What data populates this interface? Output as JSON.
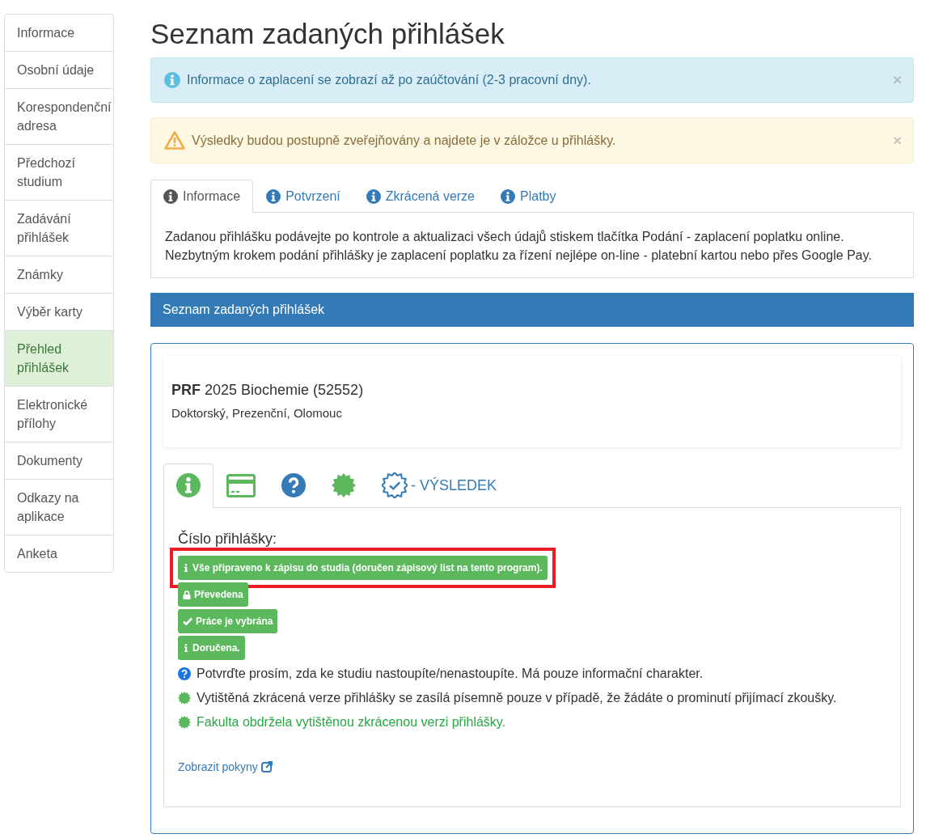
{
  "sidebar": {
    "items": [
      {
        "label": "Informace",
        "selected": false
      },
      {
        "label": "Osobní údaje",
        "selected": false
      },
      {
        "label": "Korespondenční adresa",
        "selected": false
      },
      {
        "label": "Předchozí studium",
        "selected": false
      },
      {
        "label": "Zadávání přihlášek",
        "selected": false
      },
      {
        "label": "Známky",
        "selected": false
      },
      {
        "label": "Výběr karty",
        "selected": false
      },
      {
        "label": "Přehled přihlášek",
        "selected": true
      },
      {
        "label": "Elektronické přílohy",
        "selected": false
      },
      {
        "label": "Dokumenty",
        "selected": false
      },
      {
        "label": "Odkazy na aplikace",
        "selected": false
      },
      {
        "label": "Anketa",
        "selected": false
      }
    ]
  },
  "title": "Seznam zadaných přihlášek",
  "alerts": [
    {
      "kind": "info",
      "text": "Informace o zaplacení se zobrazí až po zaúčtování (2-3 pracovní dny).",
      "close": "×"
    },
    {
      "kind": "warning",
      "text": "Výsledky budou postupně zveřejňovány a najdete je v záložce u přihlášky.",
      "close": "×"
    }
  ],
  "tabs": [
    {
      "label": "Informace",
      "selected": true
    },
    {
      "label": "Potvrzení",
      "selected": false
    },
    {
      "label": "Zkrácená verze",
      "selected": false
    },
    {
      "label": "Platby",
      "selected": false
    }
  ],
  "tab_content": [
    "Zadanou přihlášku podávejte po kontrole a aktualizaci všech údajů stiskem tlačítka Podání - zaplacení poplatku online.",
    "Nezbytným krokem podání přihlášky je zaplacení poplatku za řízení nejlépe on-line - platební kartou nebo přes Google Pay."
  ],
  "panel": {
    "heading": "Seznam zadaných přihlášek",
    "application": {
      "title": "**PRF** 2025 Biochemie (52552)",
      "details": "Doktorský, Prezenční, Olomouc",
      "icon_tabs": [
        {
          "kind": "info",
          "selected": true
        },
        {
          "kind": "card",
          "selected": false
        },
        {
          "kind": "question",
          "selected": false
        },
        {
          "kind": "seal",
          "selected": false
        },
        {
          "kind": "result",
          "label": "- VÝSLEDEK",
          "selected": false
        }
      ],
      "number_label": "Číslo přihlášky:",
      "badges": [
        {
          "kind": "info",
          "text": "Vše připraveno k zápisu do studia (doručen zápisový list na tento program).",
          "highlighted": true
        },
        {
          "kind": "lock",
          "text": "Převedena",
          "highlighted": false
        },
        {
          "kind": "check",
          "text": "Práce je vybrána",
          "highlighted": false
        },
        {
          "kind": "info",
          "text": "Doručena.",
          "highlighted": false
        }
      ],
      "notes": [
        {
          "kind": "question",
          "text": "Potvrďte prosím, zda ke studiu nastoupíte/nenastoupíte. Má pouze informační charakter.",
          "success": false
        },
        {
          "kind": "seal",
          "text": "Vytištěná zkrácená verze přihlášky se zasílá písemně pouze v případě, že žádáte o prominutí přijímací zkoušky.",
          "success": false
        },
        {
          "kind": "seal",
          "text": "Fakulta obdržela vytištěnou zkrácenou verzi přihlášky.",
          "success": true
        }
      ],
      "link": "Zobrazit pokyny"
    }
  }
}
